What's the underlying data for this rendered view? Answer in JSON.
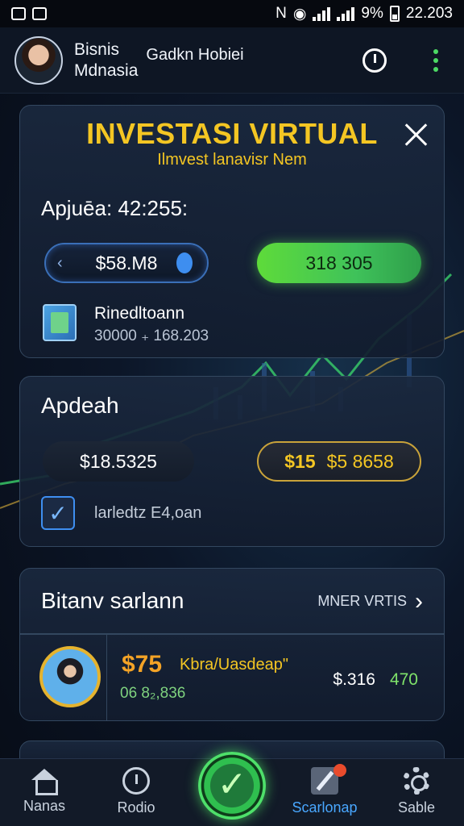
{
  "status_bar": {
    "left_icons": [
      "image-icon",
      "sim-icon"
    ],
    "battery": "9%",
    "time": "22.203"
  },
  "header": {
    "user_name_line1": "Bisnis",
    "user_name_line2": "Mdnasia",
    "app_name": "Gadkn Hobiei"
  },
  "invest_card": {
    "title": "INVESTASI VIRTUAL",
    "subtitle": "Ilmvest lanavisr Nem",
    "balance_label": "Apjuēa: 42:255:",
    "input_value": "$58.M8",
    "action_value": "318 305",
    "portfolio_name": "Rinedltoann",
    "portfolio_value": "30000 ₊ 168.203"
  },
  "apdeah_card": {
    "title": "Apdeah",
    "left_value": "$18.5325",
    "right_icon_text": "$15",
    "right_value": "$5 8658",
    "checkbox_label": "larledtz E4,oan",
    "checkbox_checked": true
  },
  "list_card": {
    "title": "Bitanv sarlann",
    "more_label": "MNER VRTIS",
    "item": {
      "price": "$75",
      "name": "Kbra/Uasdeap\"",
      "sub": "06 8₂,836",
      "value": "$.316",
      "change": "470"
    }
  },
  "bottom_nav": {
    "items": [
      {
        "label": "Nanas",
        "icon": "home-icon"
      },
      {
        "label": "Rodio",
        "icon": "radio-icon"
      },
      {
        "label": "Scarlonap",
        "icon": "edit-icon",
        "active": true
      },
      {
        "label": "Sable",
        "icon": "gear-icon"
      }
    ]
  },
  "colors": {
    "accent_gold": "#f4c623",
    "accent_green": "#4cd964",
    "accent_blue": "#3e8ef0"
  }
}
